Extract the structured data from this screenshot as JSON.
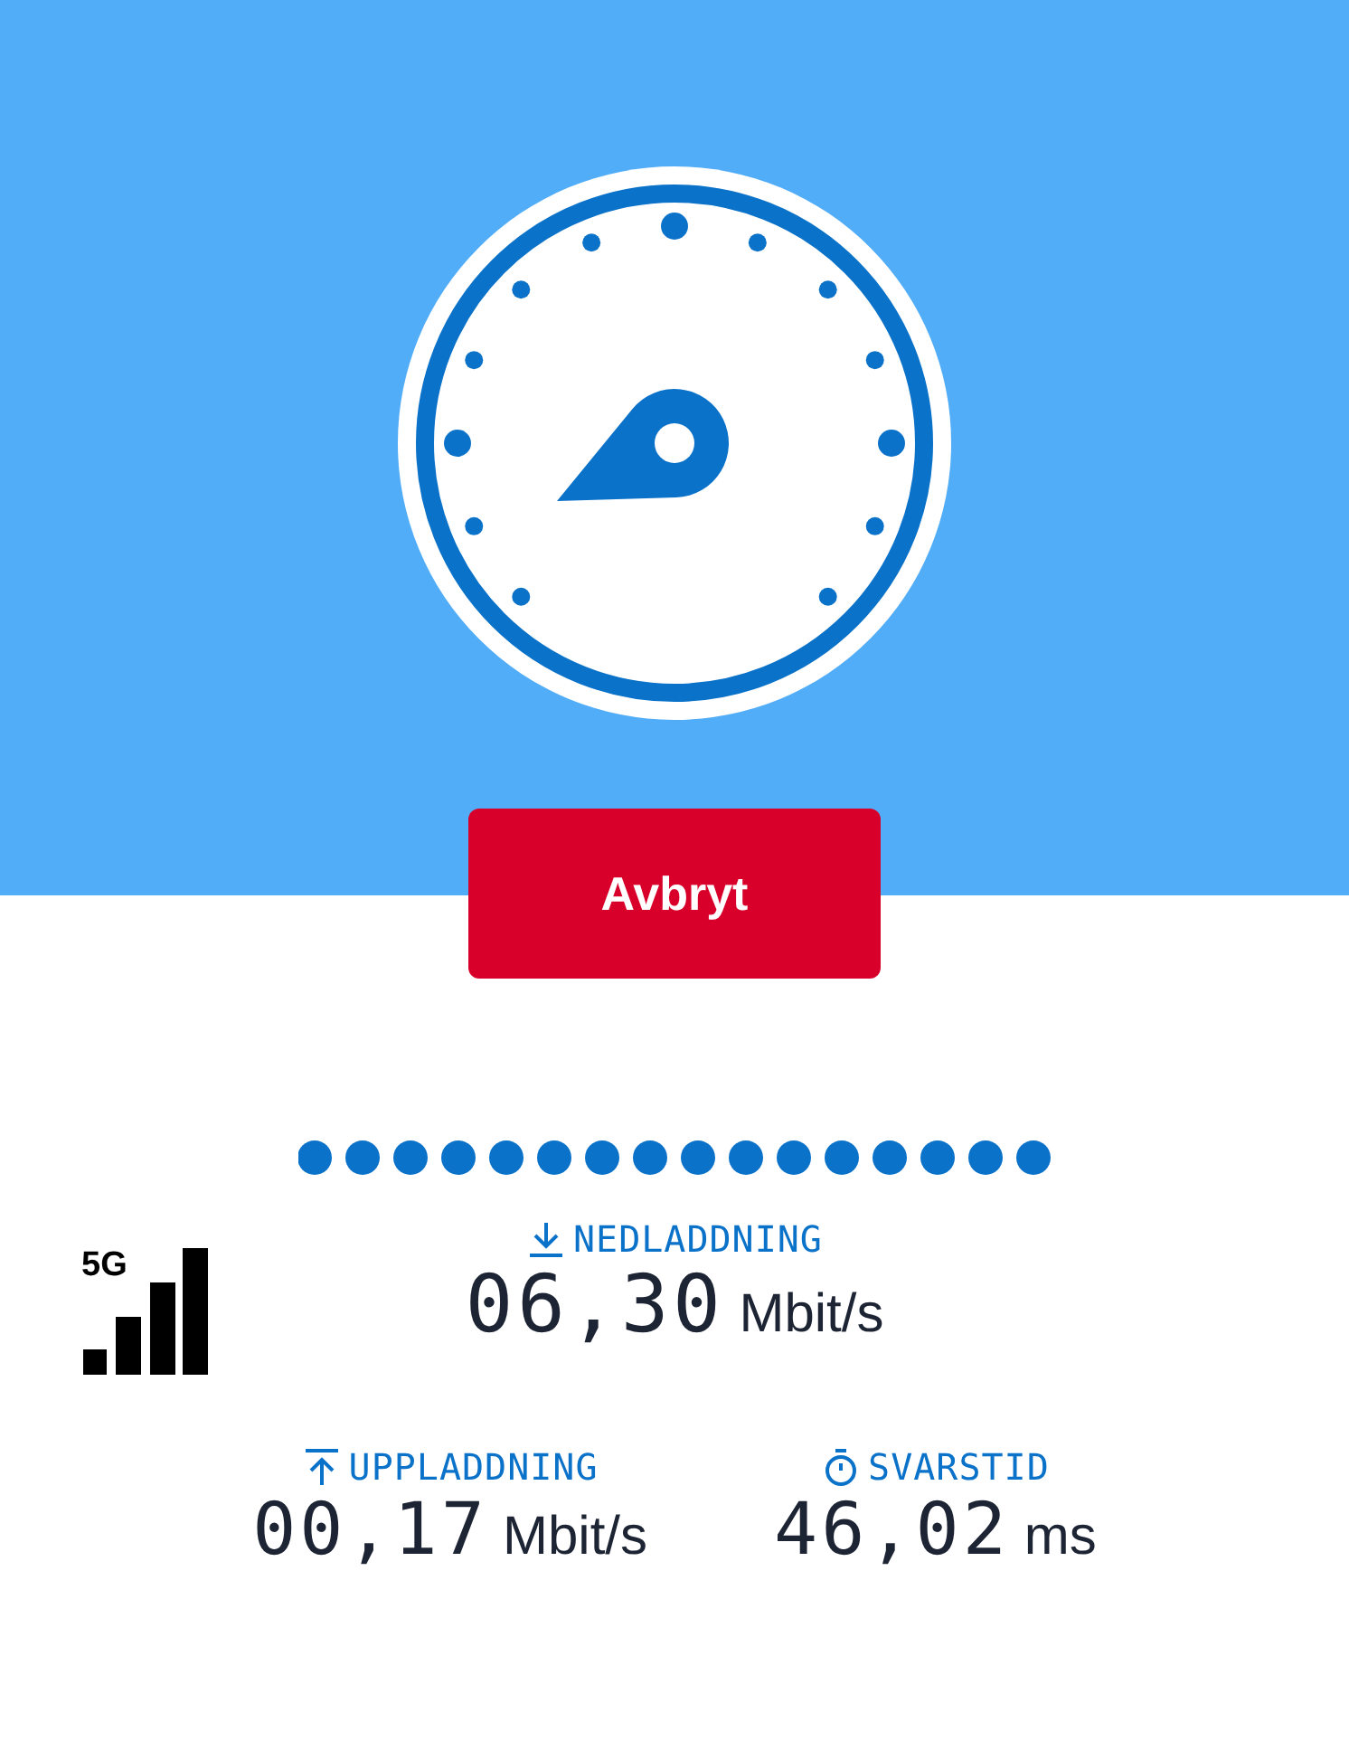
{
  "action_button": {
    "label": "Avbryt"
  },
  "network": {
    "label": "5G"
  },
  "results": [
    {
      "kind": "download",
      "label": "NEDLADDNING",
      "value": "06,30",
      "unit": "Mbit/s"
    },
    {
      "kind": "upload",
      "label": "UPPLADDNING",
      "value": "00,17",
      "unit": "Mbit/s"
    },
    {
      "kind": "latency",
      "label": "SVARSTID",
      "value": "46,02",
      "unit": "ms"
    }
  ]
}
